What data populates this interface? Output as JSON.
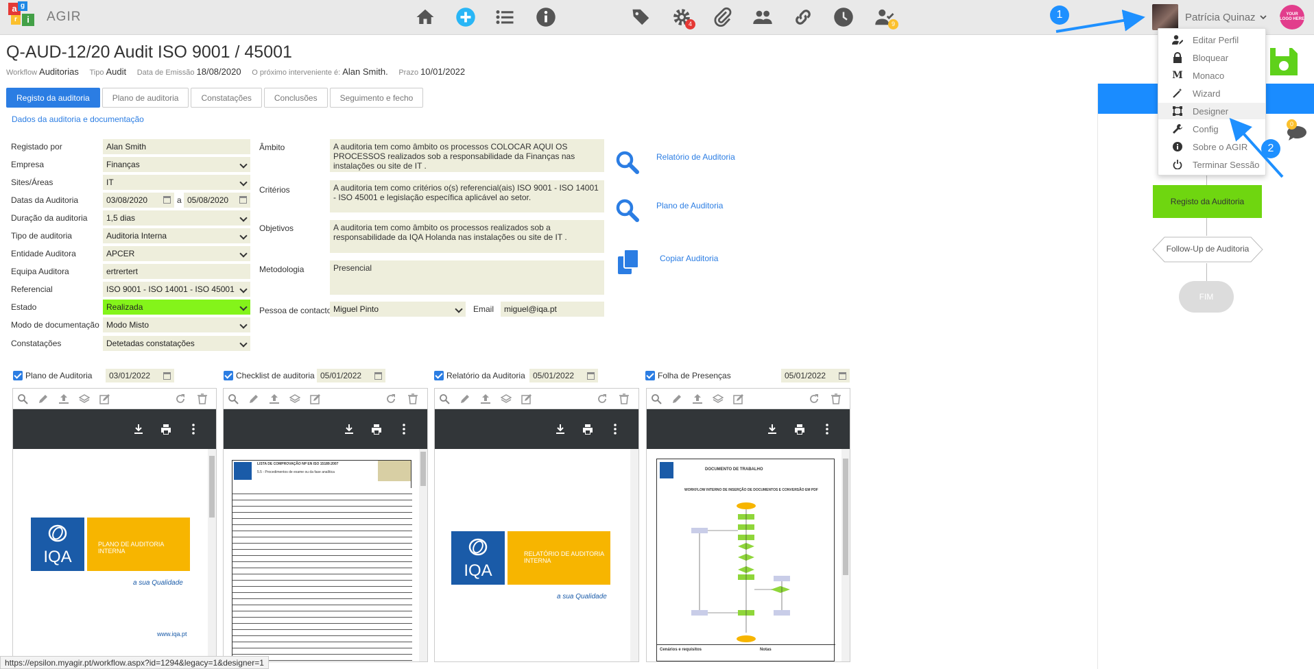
{
  "app": {
    "name": "AGIR"
  },
  "header": {
    "title": "Q-AUD-12/20 Audit ISO 9001 / 45001",
    "meta": [
      {
        "key": "Workflow",
        "value": "Auditorias"
      },
      {
        "key": "Tipo",
        "value": "Audit"
      },
      {
        "key": "Data de Emissão",
        "value": "18/08/2020"
      },
      {
        "key": "O próximo interveniente é:",
        "value": "Alan Smith."
      },
      {
        "key": "Prazo",
        "value": "10/01/2022"
      }
    ]
  },
  "topnav": {
    "icons": [
      "home-icon",
      "add-icon",
      "list-icon",
      "info-icon",
      "tag-icon",
      "settings-icon",
      "attach-icon",
      "users-icon",
      "link-icon",
      "clock-icon",
      "user-check-icon"
    ],
    "settings_badge": "4",
    "usercheck_badge": "9"
  },
  "user": {
    "name": "Patrícia Quinaz",
    "company_logo": "YOUR LOGO HERE"
  },
  "user_menu": {
    "items": [
      {
        "label": "Editar Perfil",
        "icon": "user-edit-icon"
      },
      {
        "label": "Bloquear",
        "icon": "lock-icon"
      },
      {
        "label": "Monaco",
        "icon": "monaco-icon"
      },
      {
        "label": "Wizard",
        "icon": "wand-icon"
      },
      {
        "label": "Designer",
        "icon": "designer-icon"
      },
      {
        "label": "Config",
        "icon": "wrench-icon"
      },
      {
        "label": "Sobre o AGIR",
        "icon": "info-icon"
      },
      {
        "label": "Terminar Sessão",
        "icon": "power-icon"
      }
    ],
    "highlighted": "Designer"
  },
  "annotations": {
    "badge1": "1",
    "badge2": "2"
  },
  "tabs": [
    "Registo da auditoria",
    "Plano de auditoria",
    "Constatações",
    "Conclusões",
    "Seguimento e fecho"
  ],
  "active_tab": "Registo da auditoria",
  "section_title": "Dados da auditoria e documentação",
  "form": {
    "registado_por": {
      "label": "Registado por",
      "value": "Alan Smith"
    },
    "empresa": {
      "label": "Empresa",
      "value": "Finanças"
    },
    "sites": {
      "label": "Sites/Áreas",
      "value": "IT"
    },
    "datas": {
      "label": "Datas da Auditoria",
      "from": "03/08/2020",
      "sep": "a",
      "to": "05/08/2020"
    },
    "duracao": {
      "label": "Duração da auditoria",
      "value": "1,5 dias"
    },
    "tipo": {
      "label": "Tipo de auditoria",
      "value": "Auditoria Interna"
    },
    "entidade": {
      "label": "Entidade Auditora",
      "value": "APCER"
    },
    "equipa": {
      "label": "Equipa Auditora",
      "value": "ertrertert"
    },
    "referencial": {
      "label": "Referencial",
      "value": "ISO 9001 - ISO 14001 - ISO 45001"
    },
    "estado": {
      "label": "Estado",
      "value": "Realizada"
    },
    "modo": {
      "label": "Modo de documentação",
      "value": "Modo Misto"
    },
    "constatacoes": {
      "label": "Constatações",
      "value": "Detetadas constatações"
    }
  },
  "middle": {
    "ambito": {
      "label": "Âmbito",
      "value": "A auditoria tem como âmbito os processos COLOCAR AQUI OS PROCESSOS realizados sob a responsabilidade da Finanças nas instalações ou site de IT ."
    },
    "criterios": {
      "label": "Critérios",
      "value": "A auditoria tem como critérios o(s) referencial(ais) ISO 9001 - ISO 14001 - ISO 45001 e legislação específica aplicável ao setor."
    },
    "objetivos": {
      "label": "Objetivos",
      "value": "A auditoria tem como âmbito os processos realizados sob a responsabilidade da IQA Holanda nas instalações ou site de IT ."
    },
    "metodologia": {
      "label": "Metodologia",
      "value": "Presencial"
    },
    "pessoa": {
      "label": "Pessoa de contacto",
      "value": "Miguel Pinto"
    },
    "email": {
      "label": "Email",
      "value": "miguel@iqa.pt"
    }
  },
  "links": {
    "relatorio": "Relatório de Auditoria",
    "plano": "Plano de Auditoria",
    "copiar": "Copiar Auditoria"
  },
  "attachments": [
    {
      "label": "Plano de Auditoria",
      "date": "03/01/2022",
      "doc_title": "PLANO DE AUDITORIA INTERNA",
      "tagline": "a sua Qualidade",
      "url": "www.iqa.pt"
    },
    {
      "label": "Checklist de auditoria",
      "date": "05/01/2022",
      "doc_title": "LISTA DE COMPROVAÇÃO NP EN ISO 15189:2007",
      "subtitle": "5.5 - Procedimentos de exame ou da fase analítica"
    },
    {
      "label": "Relatório da Auditoria",
      "date": "05/01/2022",
      "doc_title": "RELATÓRIO DE AUDITORIA INTERNA",
      "tagline": "a sua Qualidade"
    },
    {
      "label": "Folha de Presenças",
      "date": "05/01/2022",
      "doc_title": "DOCUMENTO DE TRABALHO",
      "subtitle": "WORKFLOW INTERNO DE INSERÇÃO DE DOCUMENTOS E CONVERSÃO EM PDF",
      "footer_left": "Cenários e requisitos",
      "footer_right": "Notas"
    }
  ],
  "iqa_logo_text": "IQA",
  "workflow": {
    "nodes": [
      "Registo da Auditoria",
      "Follow-Up de Auditoria",
      "FIM"
    ],
    "chat_badge": "0"
  },
  "status_url": "https://epsilon.myagir.pt/workflow.aspx?id=1294&legacy=1&designer=1",
  "colors": {
    "accent": "#2b7de3",
    "green": "#84f41a",
    "field_bg": "#eeeedc",
    "wf_green": "#6fd610",
    "iqa_blue": "#1a5ba8",
    "iqa_yellow": "#f7b500"
  }
}
